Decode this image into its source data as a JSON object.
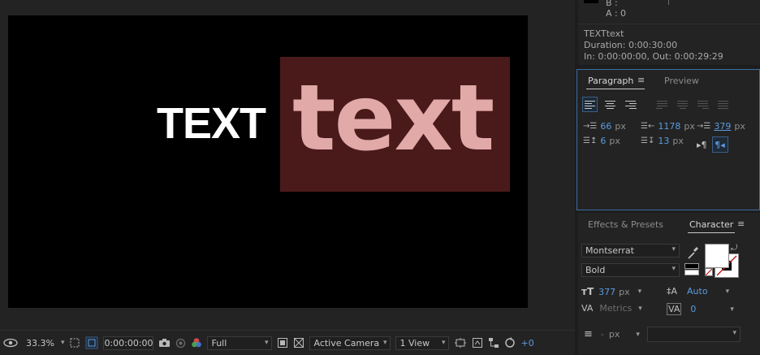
{
  "info": {
    "b_label": "B :",
    "a_label": "A :",
    "a_value": "0",
    "layer_name": "TEXTtext",
    "duration": "Duration: 0:00:30:00",
    "in_out": "In: 0:00:00:00, Out: 0:00:29:29"
  },
  "composition": {
    "text_white": "TEXT",
    "text_pink": "text"
  },
  "toolbar": {
    "zoom": "33.3%",
    "timecode": "0:00:00:00",
    "resolution": "Full",
    "camera": "Active Camera",
    "views": "1 View",
    "offset": "+0"
  },
  "paragraph": {
    "tab_paragraph": "Paragraph",
    "tab_preview": "Preview",
    "indent_left": "66",
    "indent_right": "1178",
    "indent_first": "379",
    "space_before": "6",
    "space_after": "13",
    "unit": "px"
  },
  "character": {
    "tab_effects": "Effects & Presets",
    "tab_character": "Character",
    "font_family": "Montserrat",
    "font_style": "Bold",
    "font_size": "377",
    "leading": "Auto",
    "kerning": "Metrics",
    "tracking": "0",
    "stroke_width": "-",
    "unit": "px"
  },
  "colors": {
    "comp_background": "#000000",
    "text_bbox": "#4a1a1a",
    "text_pink": "#e2a9a9",
    "accent_blue": "#5a9be0",
    "panel_focus": "#3b6ea5"
  }
}
